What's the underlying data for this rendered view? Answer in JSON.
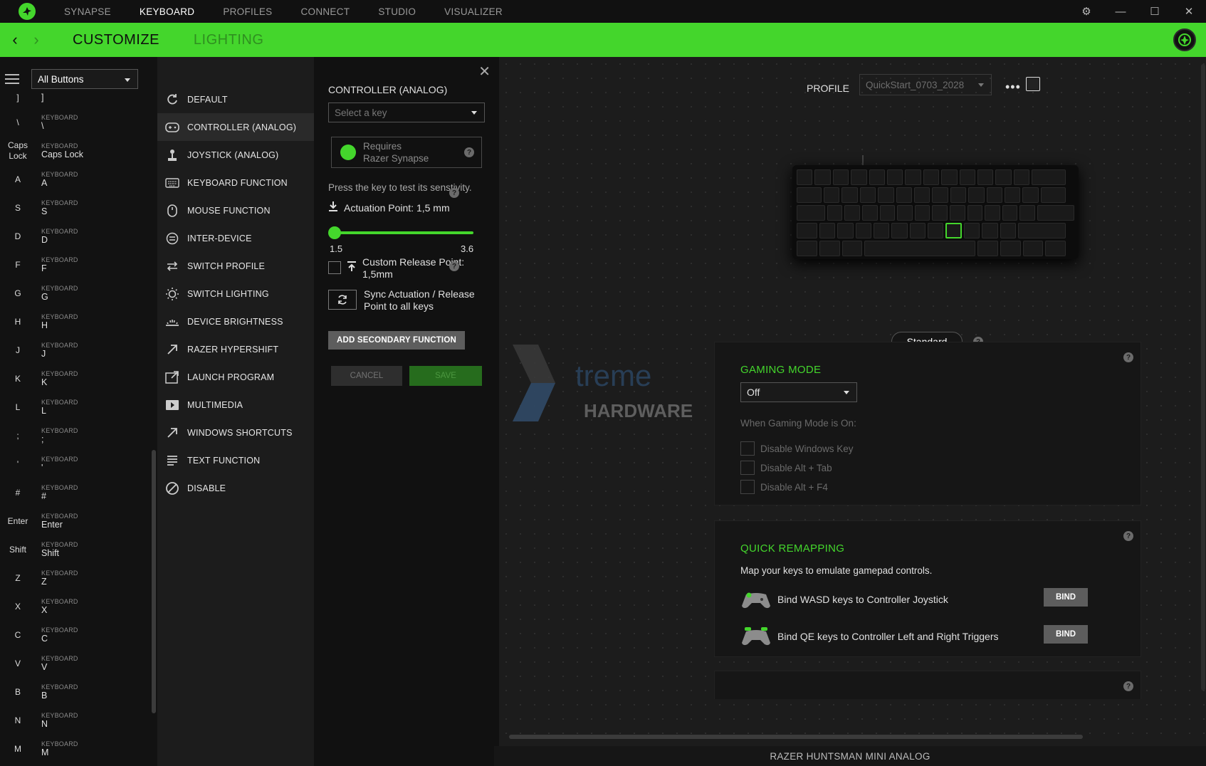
{
  "topnav": {
    "items": [
      "SYNAPSE",
      "KEYBOARD",
      "PROFILES",
      "CONNECT",
      "STUDIO",
      "VISUALIZER"
    ],
    "active": "KEYBOARD"
  },
  "greenbar": {
    "tabs": [
      "CUSTOMIZE",
      "LIGHTING"
    ],
    "active": "CUSTOMIZE"
  },
  "keylist": {
    "filter": "All Buttons",
    "category": "KEYBOARD",
    "items": [
      {
        "label": "]",
        "value": "]"
      },
      {
        "label": "\\",
        "value": "\\"
      },
      {
        "label": "Caps Lock",
        "value": "Caps Lock"
      },
      {
        "label": "A",
        "value": "A"
      },
      {
        "label": "S",
        "value": "S"
      },
      {
        "label": "D",
        "value": "D"
      },
      {
        "label": "F",
        "value": "F"
      },
      {
        "label": "G",
        "value": "G"
      },
      {
        "label": "H",
        "value": "H"
      },
      {
        "label": "J",
        "value": "J"
      },
      {
        "label": "K",
        "value": "K"
      },
      {
        "label": "L",
        "value": "L"
      },
      {
        "label": ";",
        "value": ";"
      },
      {
        "label": "'",
        "value": "'"
      },
      {
        "label": "#",
        "value": "#"
      },
      {
        "label": "Enter",
        "value": "Enter"
      },
      {
        "label": "Shift",
        "value": "Shift"
      },
      {
        "label": "Z",
        "value": "Z"
      },
      {
        "label": "X",
        "value": "X"
      },
      {
        "label": "C",
        "value": "C"
      },
      {
        "label": "V",
        "value": "V"
      },
      {
        "label": "B",
        "value": "B"
      },
      {
        "label": "N",
        "value": "N"
      },
      {
        "label": "M",
        "value": "M"
      }
    ]
  },
  "functions": {
    "items": [
      {
        "label": "DEFAULT",
        "icon": "reset-icon"
      },
      {
        "label": "CONTROLLER (ANALOG)",
        "icon": "gamepad-icon"
      },
      {
        "label": "JOYSTICK (ANALOG)",
        "icon": "joystick-icon"
      },
      {
        "label": "KEYBOARD FUNCTION",
        "icon": "keyboard-icon"
      },
      {
        "label": "MOUSE FUNCTION",
        "icon": "mouse-icon"
      },
      {
        "label": "INTER-DEVICE",
        "icon": "inter-device-icon"
      },
      {
        "label": "SWITCH PROFILE",
        "icon": "switch-icon"
      },
      {
        "label": "SWITCH LIGHTING",
        "icon": "sun-icon"
      },
      {
        "label": "DEVICE BRIGHTNESS",
        "icon": "brightness-icon"
      },
      {
        "label": "RAZER HYPERSHIFT",
        "icon": "hypershift-icon"
      },
      {
        "label": "LAUNCH PROGRAM",
        "icon": "launch-icon"
      },
      {
        "label": "MULTIMEDIA",
        "icon": "play-icon"
      },
      {
        "label": "WINDOWS SHORTCUTS",
        "icon": "shortcut-icon"
      },
      {
        "label": "TEXT FUNCTION",
        "icon": "text-icon"
      },
      {
        "label": "DISABLE",
        "icon": "disable-icon"
      }
    ],
    "active": "CONTROLLER (ANALOG)"
  },
  "config": {
    "title": "CONTROLLER (ANALOG)",
    "select_placeholder": "Select a key",
    "requires_line1": "Requires",
    "requires_line2": "Razer Synapse",
    "press_info": "Press the key to test its senstivity.",
    "actuation_label": "Actuation Point: 1,5 mm",
    "slider_min": "1.5",
    "slider_max": "3.6",
    "slider_value_fraction": 0,
    "custom_release_line1": "Custom Release Point:",
    "custom_release_line2": "1,5mm",
    "sync_line1": "Sync Actuation / Release",
    "sync_line2": "Point to all keys",
    "secondary_button": "ADD SECONDARY FUNCTION",
    "cancel_button": "CANCEL",
    "save_button": "SAVE"
  },
  "profile": {
    "label": "PROFILE",
    "value": "QuickStart_0703_2028",
    "more": "•••"
  },
  "mode": {
    "label": "Standard"
  },
  "gaming_mode": {
    "title": "GAMING MODE",
    "value": "Off",
    "when_label": "When Gaming Mode is On:",
    "options": [
      "Disable Windows Key",
      "Disable Alt + Tab",
      "Disable Alt + F4"
    ]
  },
  "quick_remap": {
    "title": "QUICK REMAPPING",
    "desc": "Map your keys to emulate gamepad controls.",
    "rows": [
      {
        "label": "Bind WASD keys to Controller Joystick",
        "button": "BIND"
      },
      {
        "label": "Bind QE keys to Controller Left and Right Triggers",
        "button": "BIND"
      }
    ]
  },
  "watermark": {
    "line1": "treme",
    "line2": "HARDWARE"
  },
  "device_name": "RAZER HUNTSMAN MINI ANALOG",
  "colors": {
    "accent": "#44d62c",
    "bg": "#1b1b1b"
  }
}
